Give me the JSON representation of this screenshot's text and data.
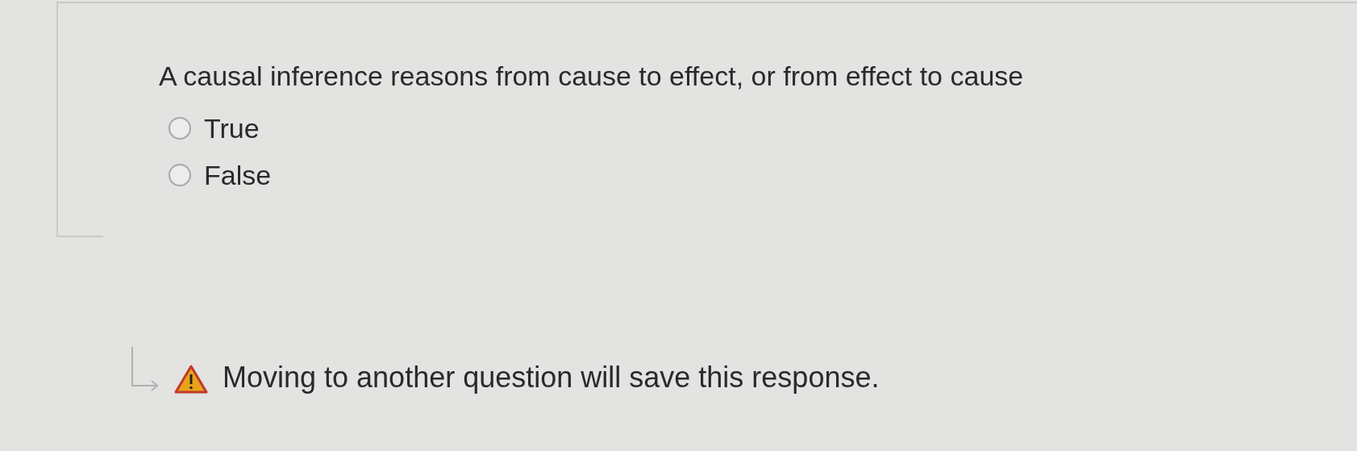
{
  "question": {
    "text": "A causal inference reasons from cause to effect, or from effect to cause",
    "options": [
      {
        "label": "True",
        "selected": false
      },
      {
        "label": "False",
        "selected": false
      }
    ]
  },
  "notice": {
    "text": "Moving to another question will save this response."
  }
}
